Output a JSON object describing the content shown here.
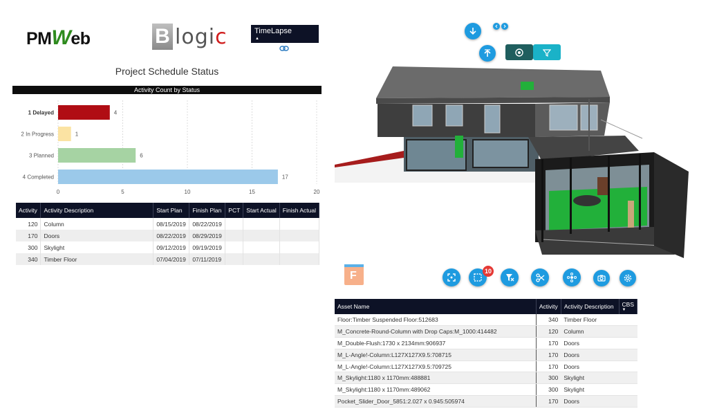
{
  "logos": {
    "pmweb": {
      "pm": "PM",
      "w": "W",
      "eb": "eb"
    },
    "blogic": {
      "b": "B",
      "logi": "logi",
      "c": "c"
    }
  },
  "timelapse": {
    "label": "TimeLapse"
  },
  "page_title": "Project Schedule Status",
  "chart_header": "Activity Count by Status",
  "chart_data": {
    "type": "bar",
    "orientation": "horizontal",
    "title": "Activity Count by Status",
    "categories": [
      "1 Delayed",
      "2 In Progress",
      "3 Planned",
      "4 Completed"
    ],
    "values": [
      4,
      1,
      6,
      17
    ],
    "colors": [
      "#b00d14",
      "#fbe3a3",
      "#a6d3a3",
      "#9bc9ea"
    ],
    "xlim": [
      0,
      20
    ],
    "xticks": [
      0,
      5,
      10,
      15,
      20
    ],
    "grid": true
  },
  "activity_table": {
    "columns": [
      "Activity",
      "Activity Description",
      "Start Plan",
      "Finish Plan",
      "PCT",
      "Start Actual",
      "Finish Actual"
    ],
    "rows": [
      {
        "activity": "120",
        "desc": "Column",
        "start_plan": "08/15/2019",
        "finish_plan": "08/22/2019",
        "pct": "",
        "start_actual": "",
        "finish_actual": ""
      },
      {
        "activity": "170",
        "desc": "Doors",
        "start_plan": "08/22/2019",
        "finish_plan": "08/29/2019",
        "pct": "",
        "start_actual": "",
        "finish_actual": ""
      },
      {
        "activity": "300",
        "desc": "Skylight",
        "start_plan": "09/12/2019",
        "finish_plan": "09/19/2019",
        "pct": "",
        "start_actual": "",
        "finish_actual": ""
      },
      {
        "activity": "340",
        "desc": "Timber Floor",
        "start_plan": "07/04/2019",
        "finish_plan": "07/11/2019",
        "pct": "",
        "start_actual": "",
        "finish_actual": ""
      }
    ]
  },
  "viewer": {
    "selection_count": "10",
    "f_label": "F",
    "colors": {
      "accent": "#1e9be0",
      "teal": "#1f5e5e",
      "selected": "#22b03a"
    },
    "icons": [
      "move-down-icon",
      "arrows-horizontal-icon",
      "level-up-icon",
      "target-icon",
      "filter-icon",
      "fit-view-icon",
      "selection-box-icon",
      "clear-filter-icon",
      "section-cut-icon",
      "explode-icon",
      "camera-icon",
      "settings-icon"
    ]
  },
  "asset_table": {
    "columns": [
      "Asset Name",
      "Activity",
      "Activity Description",
      "CBS"
    ],
    "rows": [
      {
        "asset": "Floor:Timber Suspended Floor:512683",
        "activity": "340",
        "desc": "Timber Floor"
      },
      {
        "asset": "M_Concrete-Round-Column with Drop Caps:M_1000:414482",
        "activity": "120",
        "desc": "Column"
      },
      {
        "asset": "M_Double-Flush:1730 x 2134mm:906937",
        "activity": "170",
        "desc": "Doors"
      },
      {
        "asset": "M_L-Angle!-Column:L127X127X9.5:708715",
        "activity": "170",
        "desc": "Doors"
      },
      {
        "asset": "M_L-Angle!-Column:L127X127X9.5:709725",
        "activity": "170",
        "desc": "Doors"
      },
      {
        "asset": "M_Skylight:1180 x 1170mm:488881",
        "activity": "300",
        "desc": "Skylight"
      },
      {
        "asset": "M_Skylight:1180 x 1170mm:489062",
        "activity": "300",
        "desc": "Skylight"
      },
      {
        "asset": "Pocket_Slider_Door_5851:2.027 x 0.945:505974",
        "activity": "170",
        "desc": "Doors"
      }
    ]
  }
}
